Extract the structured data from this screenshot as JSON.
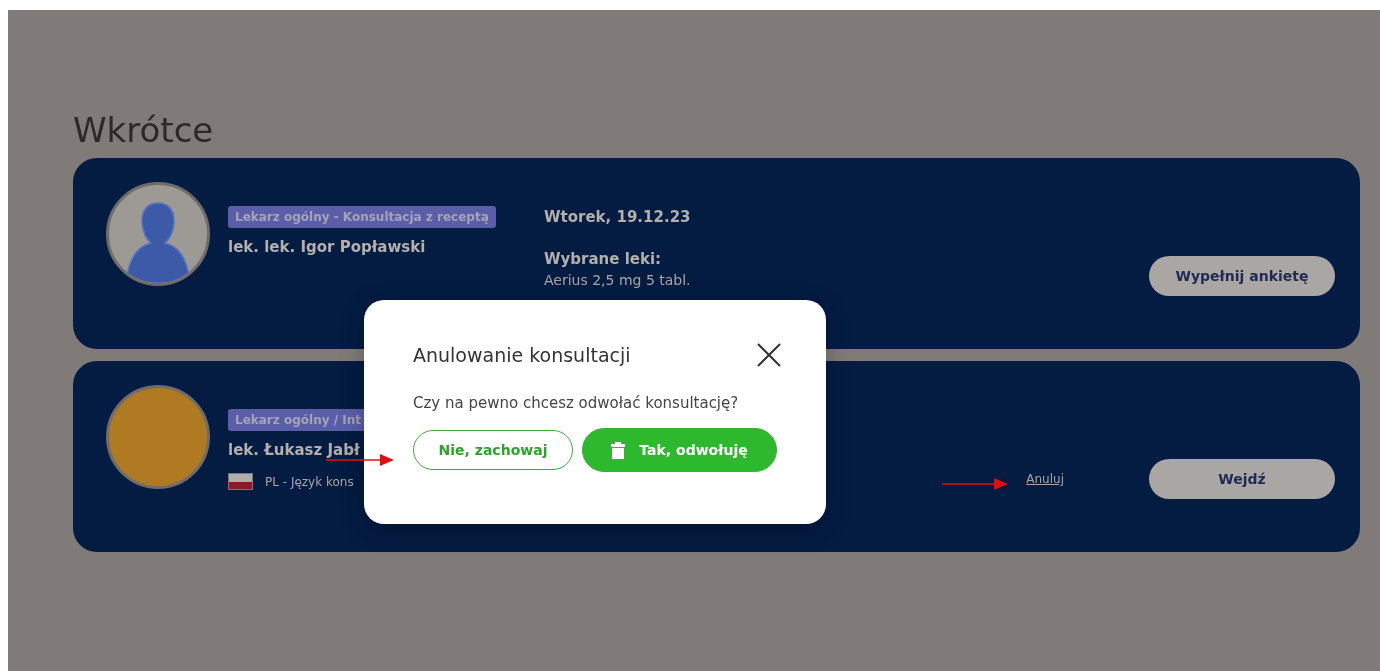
{
  "heading": "Wkrótce",
  "appointments": [
    {
      "kind": "silhouette",
      "specialty": "Lekarz ogólny - Konsultacja z receptą",
      "doctor": "lek. lek. Igor Popławski",
      "date": "Wtorek, 19.12.23",
      "medicines_label": "Wybrane leki:",
      "medicines": "Aerius 2,5 mg 5 tabl.",
      "action": "Wypełnij ankietę"
    },
    {
      "kind": "photo",
      "specialty": "Lekarz ogólny / Int",
      "doctor": "lek. Łukasz Jabł",
      "language": "PL - Język kons",
      "cancel_link": "Anuluj",
      "action": "Wejdź"
    }
  ],
  "dialog": {
    "title": "Anulowanie konsultacji",
    "message": "Czy na pewno chcesz odwołać konsultację?",
    "buttons": [
      {
        "kind": "outline",
        "label": "Nie, zachowaj"
      },
      {
        "kind": "filled",
        "label": "Tak, odwołuję"
      }
    ]
  }
}
